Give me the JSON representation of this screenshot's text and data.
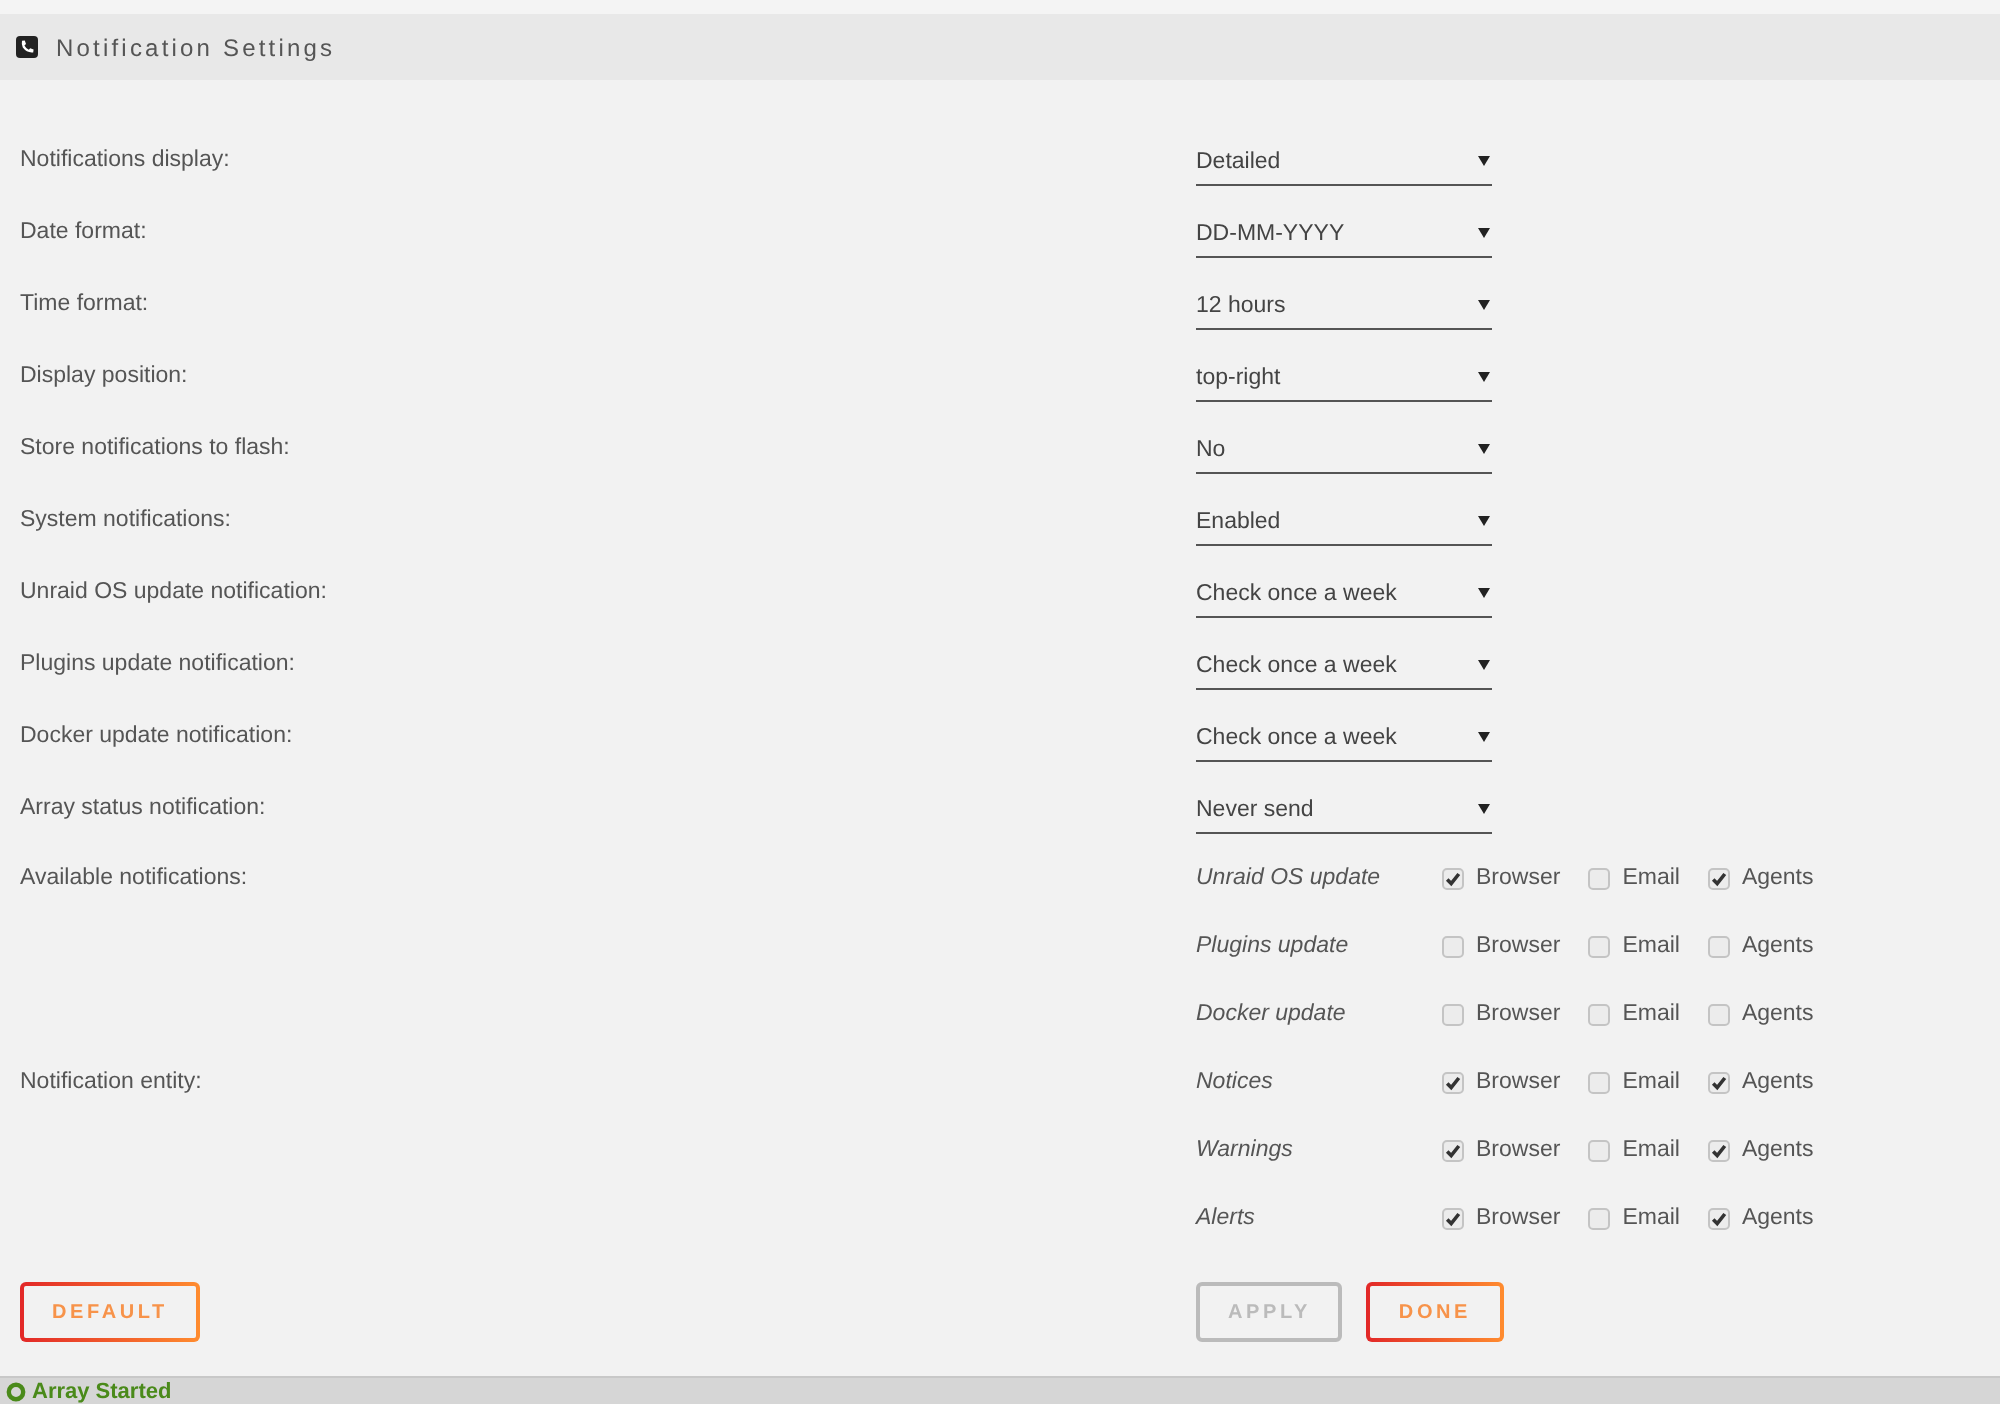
{
  "header": {
    "title": "Notification Settings"
  },
  "settings": [
    {
      "label": "Notifications display:",
      "value": "Detailed"
    },
    {
      "label": "Date format:",
      "value": "DD-MM-YYYY"
    },
    {
      "label": "Time format:",
      "value": "12 hours"
    },
    {
      "label": "Display position:",
      "value": "top-right"
    },
    {
      "label": "Store notifications to flash:",
      "value": "No"
    },
    {
      "label": "System notifications:",
      "value": "Enabled"
    },
    {
      "label": "Unraid OS update notification:",
      "value": "Check once a week"
    },
    {
      "label": "Plugins update notification:",
      "value": "Check once a week"
    },
    {
      "label": "Docker update notification:",
      "value": "Check once a week"
    },
    {
      "label": "Array status notification:",
      "value": "Never send"
    }
  ],
  "notification_groups": [
    {
      "label": "Available notifications:",
      "items": [
        {
          "name": "Unraid OS update",
          "options": [
            {
              "label": "Browser",
              "checked": true
            },
            {
              "label": "Email",
              "checked": false
            },
            {
              "label": "Agents",
              "checked": true
            }
          ]
        },
        {
          "name": "Plugins update",
          "options": [
            {
              "label": "Browser",
              "checked": false
            },
            {
              "label": "Email",
              "checked": false
            },
            {
              "label": "Agents",
              "checked": false
            }
          ]
        },
        {
          "name": "Docker update",
          "options": [
            {
              "label": "Browser",
              "checked": false
            },
            {
              "label": "Email",
              "checked": false
            },
            {
              "label": "Agents",
              "checked": false
            }
          ]
        }
      ]
    },
    {
      "label": "Notification entity:",
      "items": [
        {
          "name": "Notices",
          "options": [
            {
              "label": "Browser",
              "checked": true
            },
            {
              "label": "Email",
              "checked": false
            },
            {
              "label": "Agents",
              "checked": true
            }
          ]
        },
        {
          "name": "Warnings",
          "options": [
            {
              "label": "Browser",
              "checked": true
            },
            {
              "label": "Email",
              "checked": false
            },
            {
              "label": "Agents",
              "checked": true
            }
          ]
        },
        {
          "name": "Alerts",
          "options": [
            {
              "label": "Browser",
              "checked": true
            },
            {
              "label": "Email",
              "checked": false
            },
            {
              "label": "Agents",
              "checked": true
            }
          ]
        }
      ]
    }
  ],
  "footer": {
    "left_buttons": [
      {
        "label": "DEFAULT",
        "disabled": false
      }
    ],
    "right_buttons": [
      {
        "label": "APPLY",
        "disabled": true
      },
      {
        "label": "DONE",
        "disabled": false
      }
    ]
  },
  "status_bar": {
    "text": "Array Started"
  }
}
